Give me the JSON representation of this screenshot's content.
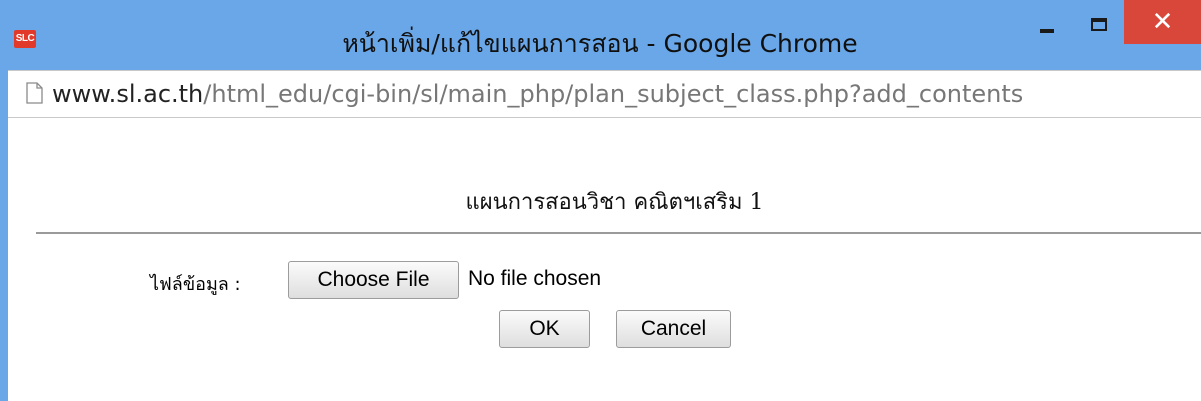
{
  "window": {
    "logo_text": "SLC",
    "title": "หน้าเพิ่ม/แก้ไขแผนการสอน - Google Chrome",
    "minimize_glyph": "",
    "maximize_glyph": "",
    "close_glyph": "✕"
  },
  "address": {
    "host": "www.sl.ac.th",
    "path": "/html_edu/cgi-bin/sl/main_php/plan_subject_class.php?add_contents"
  },
  "page": {
    "heading": "แผนการสอนวิชา คณิตฯเสริม 1",
    "file_label": "ไฟล์ข้อมูล :",
    "choose_file_label": "Choose File",
    "file_status": "No file chosen",
    "ok_label": "OK",
    "cancel_label": "Cancel"
  },
  "colors": {
    "titlebar": "#6aa7e8",
    "close_button": "#d9463a",
    "logo": "#e23a2a"
  }
}
